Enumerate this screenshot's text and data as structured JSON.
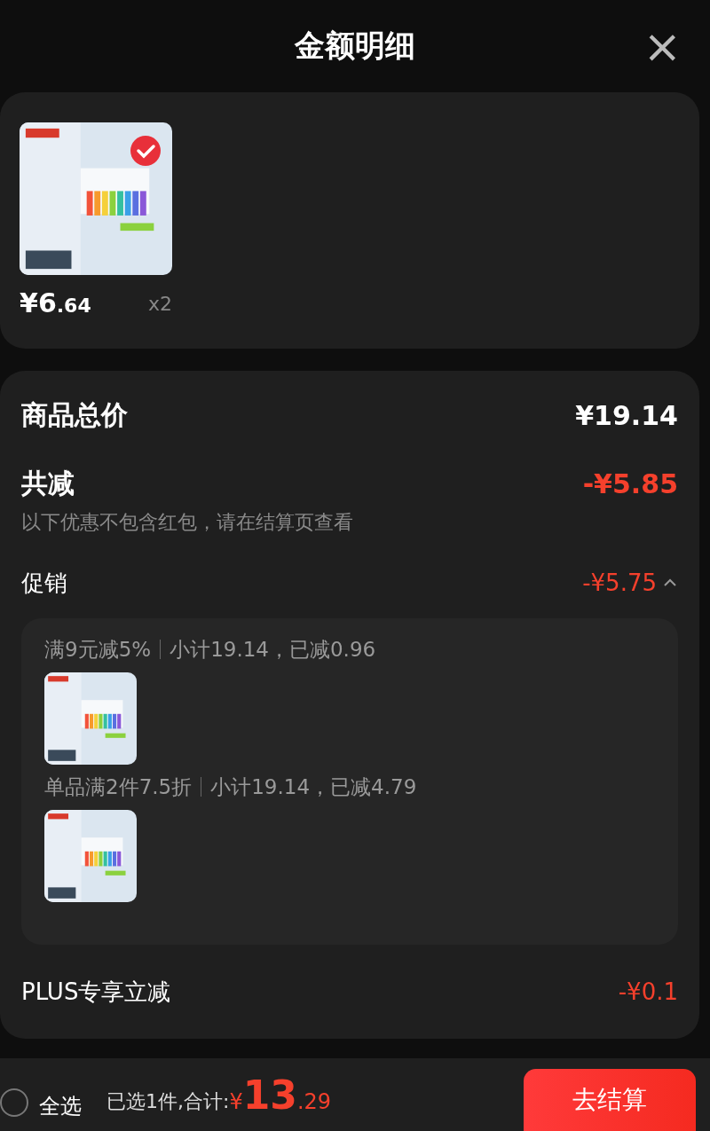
{
  "header": {
    "title": "金额明细",
    "close": "×"
  },
  "product": {
    "kind": "picture",
    "selected": true,
    "price_symbol": "¥",
    "price_int": "6",
    "price_dec": ".64",
    "quantity": "x2"
  },
  "summary": {
    "total_label": "商品总价",
    "total_value": "¥19.14",
    "discount_label": "共减",
    "discount_value": "-¥5.85",
    "discount_note": "以下优惠不包含红包，请在结算页查看",
    "promo_label": "促销",
    "promo_value": "-¥5.75",
    "promo_expanded": true,
    "promotions": [
      {
        "rule": "满9元减5%",
        "detail": "小计19.14，已减0.96"
      },
      {
        "rule": "单品满2件7.5折",
        "detail": "小计19.14，已减4.79"
      }
    ],
    "plus_label": "PLUS专享立减",
    "plus_value": "-¥0.1"
  },
  "footer": {
    "select_all": "全选",
    "select_all_checked": false,
    "selected_text": "已选1件,合计:",
    "total_symbol": "¥",
    "total_int": "13",
    "total_dec": ".29",
    "checkout": "去结算"
  }
}
